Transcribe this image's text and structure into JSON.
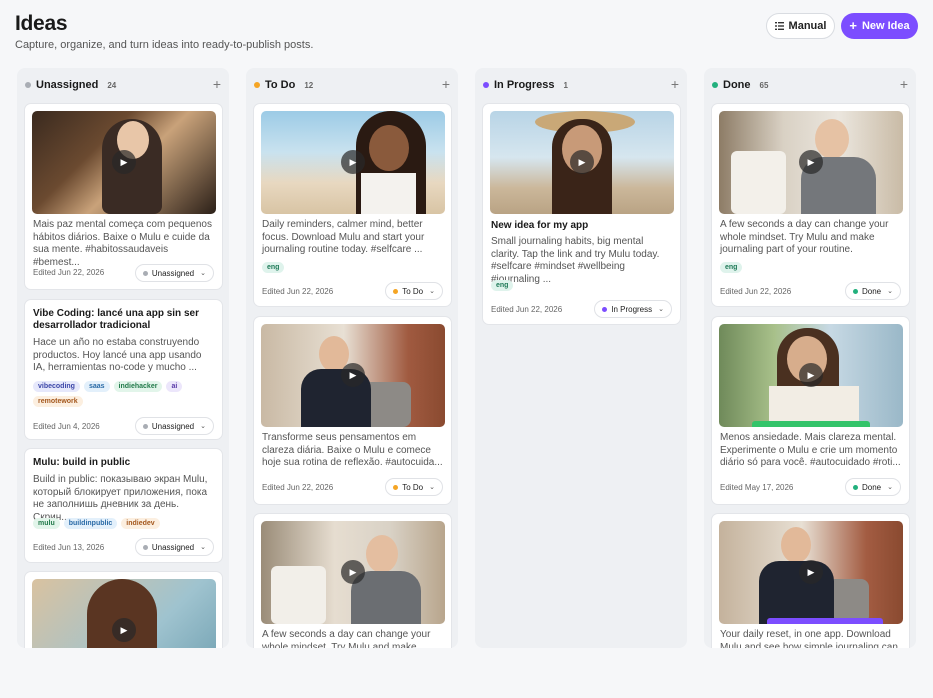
{
  "header": {
    "title": "Ideas",
    "subtitle": "Capture, organize, and turn ideas into ready-to-publish posts.",
    "manual_label": "Manual",
    "new_label": "New Idea"
  },
  "colors": {
    "accent": "#7c4dff",
    "unassigned": "#a9adb4",
    "todo": "#f5a524",
    "progress": "#7c4dff",
    "done": "#22b07d"
  },
  "columns": [
    {
      "name": "Unassigned",
      "count": "24"
    },
    {
      "name": "To Do",
      "count": "12"
    },
    {
      "name": "In Progress",
      "count": "1"
    },
    {
      "name": "Done",
      "count": "65"
    }
  ],
  "cards": {
    "u1": {
      "text": "Mais paz mental começa com pequenos hábitos diários. Baixe o Mulu e cuide da sua mente. #habitossaudaveis #bemest...",
      "edited": "Edited Jun 22, 2026",
      "status": "Unassigned"
    },
    "u2": {
      "title": "Vibe Coding: lancé una app sin ser desarrollador tradicional",
      "text": "Hace un año no estaba construyendo productos. Hoy lancé una app usando IA, herramientas no-code y mucho ...",
      "tags": [
        "vibecoding",
        "saas",
        "indiehacker",
        "ai",
        "remotework"
      ],
      "edited": "Edited Jun 4, 2026",
      "status": "Unassigned"
    },
    "u3": {
      "title": "Mulu: build in public",
      "text": "Build in public: показываю экран Mulu, который блокирует приложения, пока не заполнишь дневник за день. Скрин...",
      "tags": [
        "mulu",
        "buildinpublic",
        "indiedev"
      ],
      "edited": "Edited Jun 13, 2026",
      "status": "Unassigned"
    },
    "t1": {
      "text": "Daily reminders, calmer mind, better focus. Download Mulu and start your journaling routine today. #selfcare ...",
      "tags": [
        "eng"
      ],
      "edited": "Edited Jun 22, 2026",
      "status": "To Do"
    },
    "t2": {
      "text": "Transforme seus pensamentos em clareza diária. Baixe o Mulu e comece hoje sua rotina de reflexão. #autocuida...",
      "edited": "Edited Jun 22, 2026",
      "status": "To Do"
    },
    "t3": {
      "text": "A few seconds a day can change your whole mindset. Try Mulu and make"
    },
    "p1": {
      "title": "New idea for my app",
      "text": "Small journaling habits, big mental clarity. Tap the link and try Mulu today. #selfcare #mindset #wellbeing #journaling ...",
      "tags": [
        "eng"
      ],
      "edited": "Edited Jun 22, 2026",
      "status": "In Progress"
    },
    "d1": {
      "text": "A few seconds a day can change your whole mindset. Try Mulu and make journaling part of your routine.",
      "tags": [
        "eng"
      ],
      "edited": "Edited Jun 22, 2026",
      "status": "Done"
    },
    "d2": {
      "text": "Menos ansiedade. Mais clareza mental. Experimente o Mulu e crie um momento diário só para você. #autocuidado #roti...",
      "edited": "Edited May 17, 2026",
      "status": "Done"
    },
    "d3": {
      "text": "Your daily reset, in one app. Download Mulu and see how simple journaling can"
    }
  }
}
